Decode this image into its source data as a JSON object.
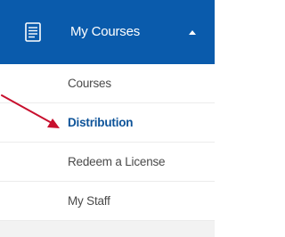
{
  "menu": {
    "header": {
      "title": "My Courses",
      "icon": "book-icon",
      "caret_icon": "caret-up-icon",
      "background_color": "#0a5bac",
      "text_color": "#ffffff"
    },
    "items": [
      {
        "label": "Courses",
        "active": false
      },
      {
        "label": "Distribution",
        "active": true
      },
      {
        "label": "Redeem a License",
        "active": false
      },
      {
        "label": "My Staff",
        "active": false
      }
    ],
    "active_item_color": "#0d5399",
    "item_text_color": "#4a4a4a"
  },
  "annotation": {
    "type": "arrow",
    "points_to": "Distribution",
    "color": "#c8102e"
  }
}
